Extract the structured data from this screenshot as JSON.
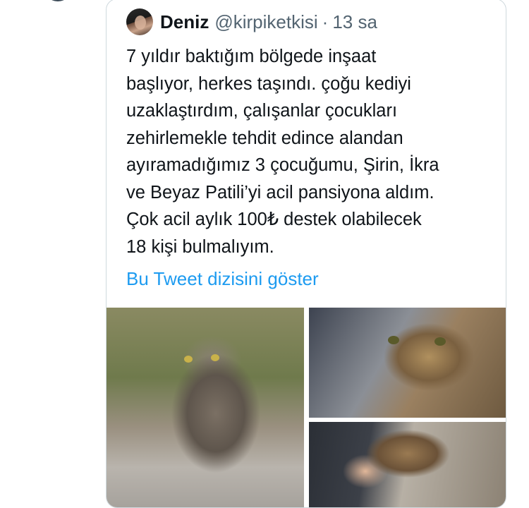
{
  "quote": {
    "display_name": "Deniz",
    "handle": "@kirpiketkisi",
    "separator": "·",
    "time": "13 sa",
    "text_lines": [
      "7 yıldır baktığım bölgede inşaat",
      "başlıyor, herkes taşındı. çoğu kediyi",
      "uzaklaştırdım, çalışanlar çocukları",
      "zehirlemekle tehdit edince alandan",
      "ayıramadığımız 3 çocuğumu, Şirin, İkra",
      "ve Beyaz Patili’yi acil pansiyona aldım.",
      "Çok acil aylık 100₺ destek olabilecek",
      "18 kişi bulmalıyım."
    ],
    "show_thread_label": "Bu Tweet dizisini göster",
    "link_color": "#1d9bf0"
  },
  "media": {
    "photo_count": 3
  }
}
